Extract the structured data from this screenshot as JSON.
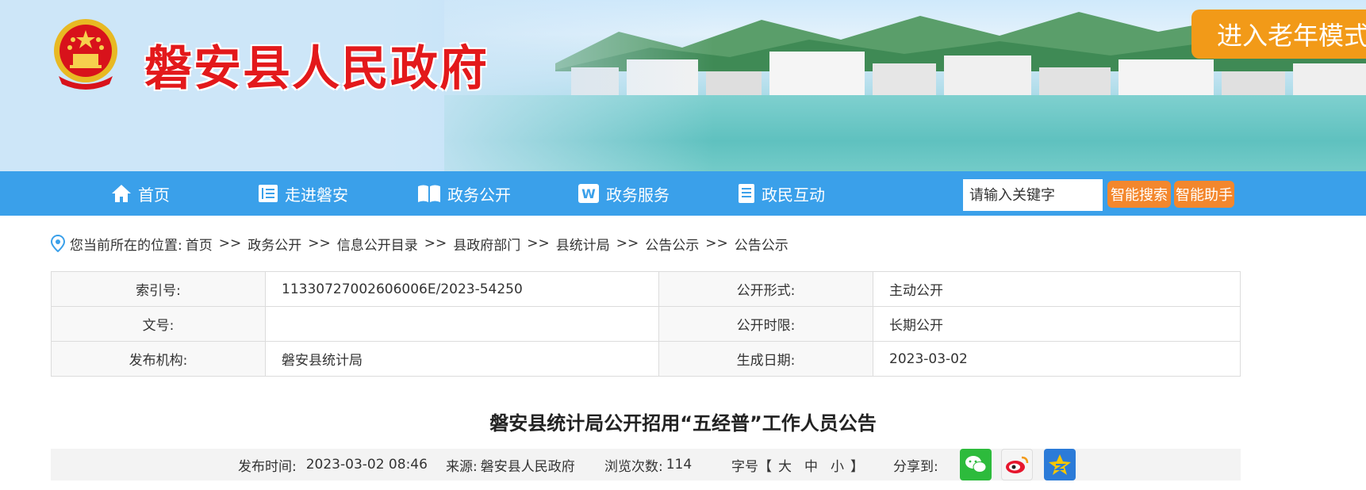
{
  "header": {
    "site_title": "磐安县人民政府",
    "elder_mode": "进入老年模式"
  },
  "nav": {
    "items": [
      {
        "label": "首页",
        "icon": "home-icon"
      },
      {
        "label": "走进磐安",
        "icon": "list-icon"
      },
      {
        "label": "政务公开",
        "icon": "book-icon"
      },
      {
        "label": "政务服务",
        "icon": "w-icon"
      },
      {
        "label": "政民互动",
        "icon": "document-icon"
      }
    ],
    "search_placeholder": "请输入关键字",
    "search_button": "智能搜索",
    "assistant_button": "智能助手"
  },
  "breadcrumb": {
    "prefix": "您当前所在的位置:",
    "items": [
      "首页",
      "政务公开",
      "信息公开目录",
      "县政府部门",
      "县统计局",
      "公告公示",
      "公告公示"
    ],
    "separator": ">>"
  },
  "meta": {
    "rows": [
      {
        "k1": "索引号:",
        "v1": "11330727002606006E/2023-54250",
        "k2": "公开形式:",
        "v2": "主动公开"
      },
      {
        "k1": "文号:",
        "v1": "",
        "k2": "公开时限:",
        "v2": "长期公开"
      },
      {
        "k1": "发布机构:",
        "v1": "磐安县统计局",
        "k2": "生成日期:",
        "v2": "2023-03-02"
      }
    ]
  },
  "article": {
    "title": "磐安县统计局公开招用“五经普”工作人员公告",
    "publish_label": "发布时间:",
    "publish_time": "2023-03-02 08:46",
    "source_label": "来源:",
    "source": "磐安县人民政府",
    "views_label": "浏览次数:",
    "views": "114",
    "font_label": "字号【",
    "font_large": "大",
    "font_medium": "中",
    "font_small": "小",
    "font_close": "】",
    "share_label": "分享到:"
  },
  "colors": {
    "nav_blue": "#3aa0ea",
    "orange": "#f3872d",
    "title_red": "#e3191b",
    "elder_orange": "#f29a18"
  }
}
